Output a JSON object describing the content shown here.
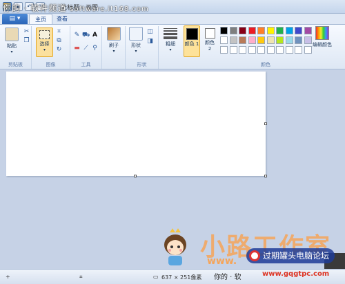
{
  "watermark": {
    "top_left": "你的 · 软件频道",
    "url": "software.it168.com",
    "big_text": "小路工作室",
    "www_text": "www.",
    "pill_text": "过期罐头电脑论坛",
    "site": "www.gqgtpc.com",
    "bottom_small": "你的 · 软"
  },
  "titlebar": {
    "title": "无标题 - 画图"
  },
  "tabs": [
    {
      "label": "主页",
      "active": true
    },
    {
      "label": "查看",
      "active": false
    }
  ],
  "ribbon": {
    "clipboard": {
      "label": "剪贴板",
      "paste": "粘贴"
    },
    "image": {
      "label": "图像",
      "select": "选择"
    },
    "tools": {
      "label": "工具"
    },
    "brushes": {
      "label": "刷子"
    },
    "shapes": {
      "label": "形状",
      "shapes_btn": "形状"
    },
    "size": {
      "label": "粗细"
    },
    "colors": {
      "label": "颜色",
      "color1": "颜色 1",
      "color2": "颜色 2",
      "edit": "编辑颜色",
      "color1_value": "#000000",
      "color2_value": "#ffffff",
      "palette": [
        "#000000",
        "#7f7f7f",
        "#880015",
        "#ed1c24",
        "#ff7f27",
        "#fff200",
        "#22b14c",
        "#00a2e8",
        "#3f48cc",
        "#a349a4",
        "#ffffff",
        "#c3c3c3",
        "#b97a57",
        "#ffaec9",
        "#ffc90e",
        "#efe4b0",
        "#b5e61d",
        "#99d9ea",
        "#7092be",
        "#c8bfe7",
        "#ffffff",
        "#ffffff",
        "#ffffff",
        "#ffffff",
        "#ffffff",
        "#ffffff",
        "#ffffff",
        "#ffffff",
        "#ffffff",
        "#ffffff"
      ]
    }
  },
  "statusbar": {
    "dimensions": "637 × 251像素"
  }
}
